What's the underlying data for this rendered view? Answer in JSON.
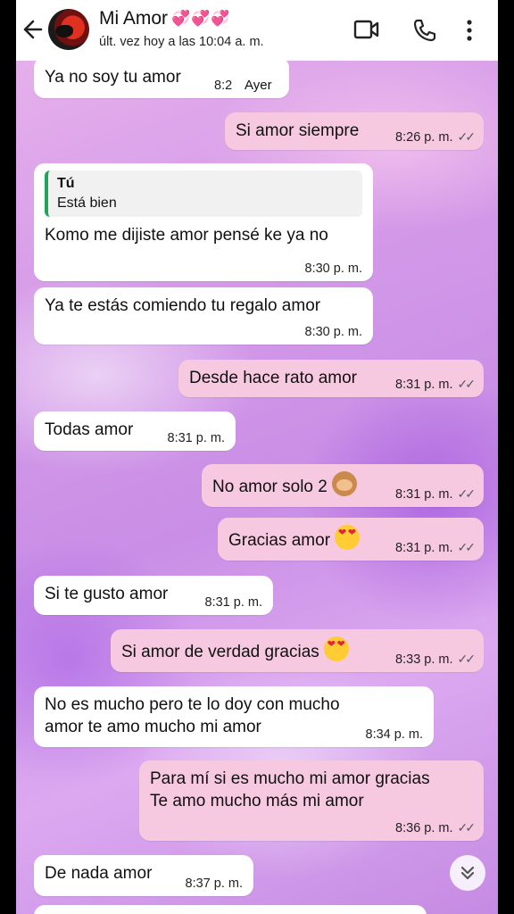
{
  "header": {
    "contact_name": "Mi Amor",
    "hearts": "💞💞💞",
    "status": "últ. vez hoy a las 10:04 a. m."
  },
  "day_label": "Ayer",
  "messages": [
    {
      "dir": "in",
      "text": "Ya no soy tu amor",
      "time": "8:2"
    },
    {
      "dir": "out",
      "text": "Si amor siempre",
      "time": "8:26 p. m."
    },
    {
      "dir": "in",
      "quote_author": "Tú",
      "quote_text": "Está bien",
      "text": "Komo me dijiste amor pensé ke ya no",
      "time": "8:30 p. m."
    },
    {
      "dir": "in",
      "text": "Ya te estás comiendo tu regalo amor",
      "time": "8:30 p. m."
    },
    {
      "dir": "out",
      "text": "Desde hace rato amor",
      "time": "8:31 p. m."
    },
    {
      "dir": "in",
      "text": "Todas amor",
      "time": "8:31 p. m."
    },
    {
      "dir": "out",
      "text": "No amor solo 2",
      "emoji": "monkey-emoji",
      "time": "8:31 p. m."
    },
    {
      "dir": "out",
      "text": "Gracias amor",
      "emoji": "heart-eyes-emoji",
      "time": "8:31 p. m."
    },
    {
      "dir": "in",
      "text": "Si te gusto amor",
      "time": "8:31 p. m."
    },
    {
      "dir": "out",
      "text": "Si amor de verdad gracias",
      "emoji": "heart-eyes-emoji",
      "time": "8:33 p. m."
    },
    {
      "dir": "in",
      "line1": "No es mucho pero te lo doy con mucho",
      "line2": "amor te amo mucho mi amor",
      "time": "8:34 p. m."
    },
    {
      "dir": "out",
      "line1": "Para mí si es mucho mi amor gracias",
      "line2": "Te amo mucho más mi amor",
      "time": "8:36 p. m."
    },
    {
      "dir": "in",
      "text": "De nada amor",
      "time": "8:37 p. m."
    }
  ],
  "read_ticks": "✓✓",
  "colors": {
    "incoming_bubble": "#ffffff",
    "outgoing_bubble": "#f6c9e0",
    "quote_bar": "#25a25a"
  }
}
